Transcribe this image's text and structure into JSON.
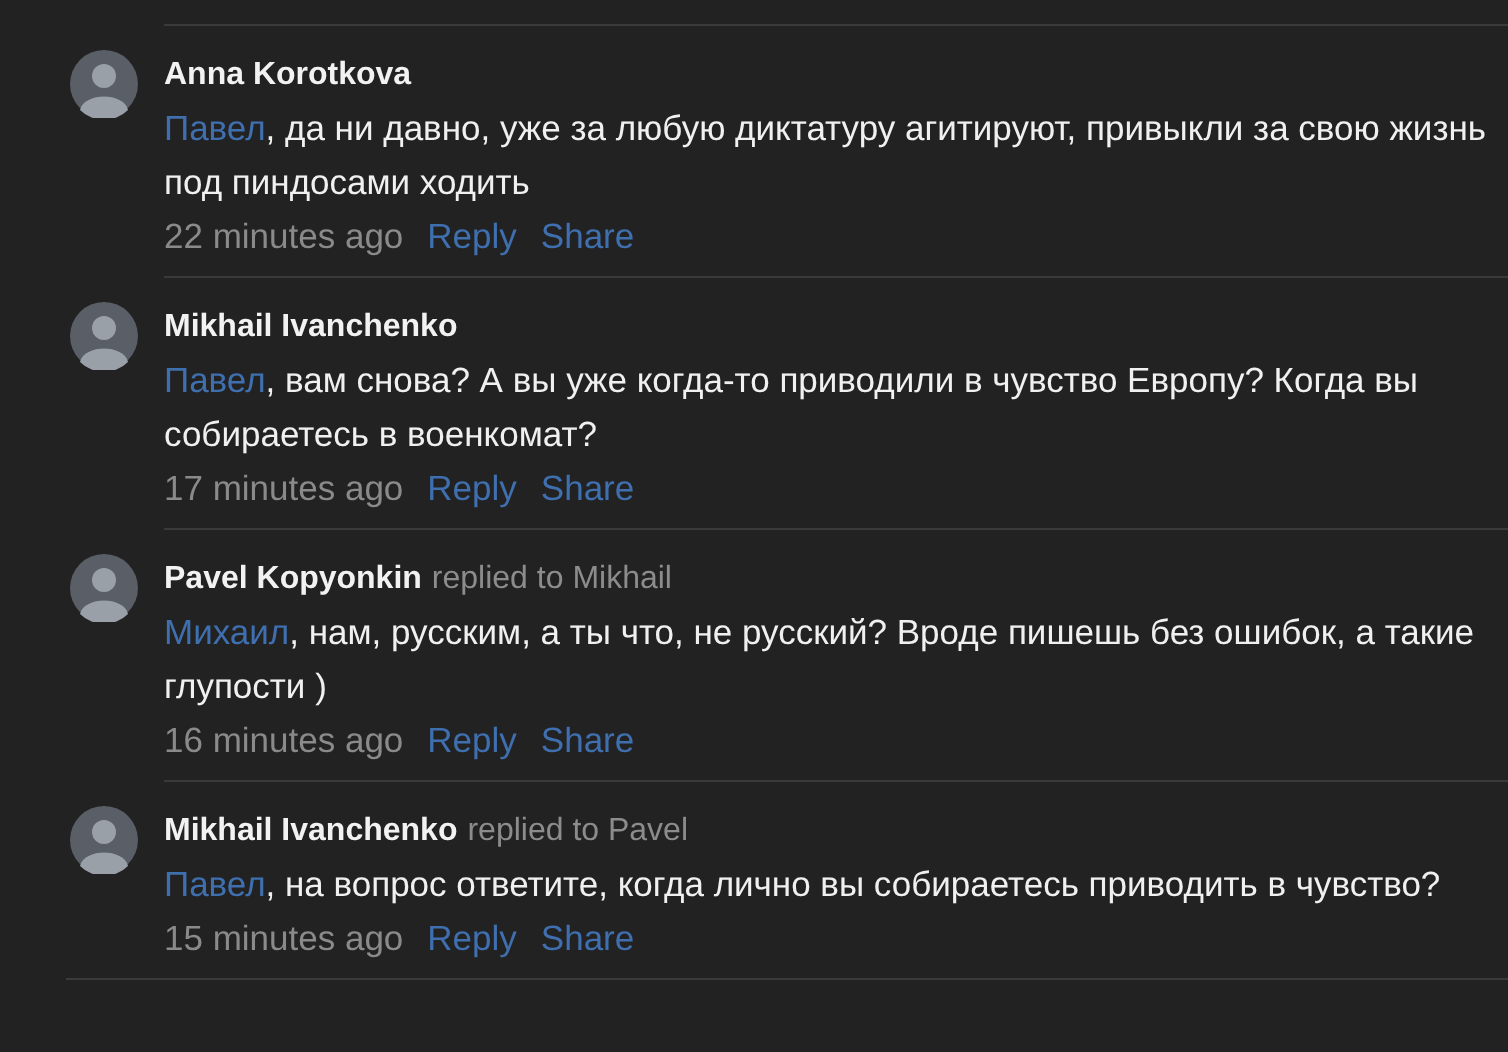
{
  "comments": [
    {
      "author": "Anna Korotkova",
      "mention": "Павел",
      "text": ", да ни давно, уже за любую диктатуру агитируют, привыкли за свою жизнь под пиндосами ходить",
      "time": "22 minutes ago",
      "actions": [
        "Reply",
        "Share"
      ]
    },
    {
      "author": "Mikhail Ivanchenko",
      "mention": "Павел",
      "text": ", вам снова? А вы уже когда-то приводили в чувство Европу? Когда вы собираетесь в военкомат?",
      "time": "17 minutes ago",
      "actions": [
        "Reply",
        "Share"
      ]
    },
    {
      "author": "Pavel Kopyonkin",
      "replied_to": "replied to Mikhail",
      "mention": "Михаил",
      "text": ", нам, русским, а ты что, не русский? Вроде пишешь без ошибок, а такие глупости )",
      "time": "16 minutes ago",
      "actions": [
        "Reply",
        "Share"
      ]
    },
    {
      "author": "Mikhail Ivanchenko",
      "replied_to": "replied to Pavel",
      "mention": "Павел",
      "text": ", на вопрос ответите, когда лично вы собираетесь приводить в чувство?",
      "time": "15 minutes ago",
      "actions": [
        "Reply",
        "Share"
      ]
    }
  ]
}
